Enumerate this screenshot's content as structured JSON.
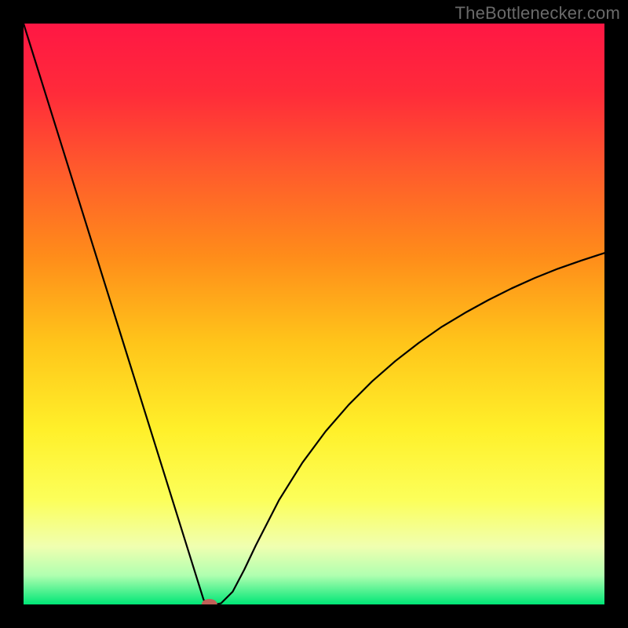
{
  "watermark": "TheBottlenecker.com",
  "chart_data": {
    "type": "line",
    "title": "",
    "xlabel": "",
    "ylabel": "",
    "xlim": [
      0,
      100
    ],
    "ylim": [
      0,
      100
    ],
    "grid": false,
    "legend": false,
    "gradient_stops": [
      {
        "pct": 0,
        "color": "#ff1744"
      },
      {
        "pct": 12,
        "color": "#ff2b3a"
      },
      {
        "pct": 25,
        "color": "#ff5a2c"
      },
      {
        "pct": 40,
        "color": "#ff8c1a"
      },
      {
        "pct": 55,
        "color": "#ffc51a"
      },
      {
        "pct": 70,
        "color": "#fff02a"
      },
      {
        "pct": 82,
        "color": "#fcff5a"
      },
      {
        "pct": 90,
        "color": "#f0ffb0"
      },
      {
        "pct": 95,
        "color": "#b0ffb0"
      },
      {
        "pct": 100,
        "color": "#00e676"
      }
    ],
    "series": [
      {
        "name": "bottleneck-curve",
        "x": [
          0,
          2,
          4,
          6,
          8,
          10,
          12,
          14,
          16,
          18,
          20,
          22,
          24,
          26,
          28,
          30,
          31,
          32,
          33,
          34,
          36,
          38,
          40,
          44,
          48,
          52,
          56,
          60,
          64,
          68,
          72,
          76,
          80,
          84,
          88,
          92,
          96,
          100
        ],
        "y": [
          100,
          93.6,
          87.2,
          80.8,
          74.4,
          68,
          61.6,
          55.2,
          48.8,
          42.4,
          36,
          29.6,
          23.2,
          16.8,
          10.4,
          4,
          0.8,
          0,
          0,
          0.2,
          2.2,
          6.0,
          10.2,
          18.0,
          24.4,
          29.8,
          34.4,
          38.4,
          41.9,
          45.0,
          47.8,
          50.2,
          52.4,
          54.4,
          56.2,
          57.8,
          59.2,
          60.5
        ]
      }
    ],
    "marker": {
      "x": 32,
      "y": 0,
      "color": "#c06058",
      "rx": 10,
      "ry": 7
    }
  }
}
